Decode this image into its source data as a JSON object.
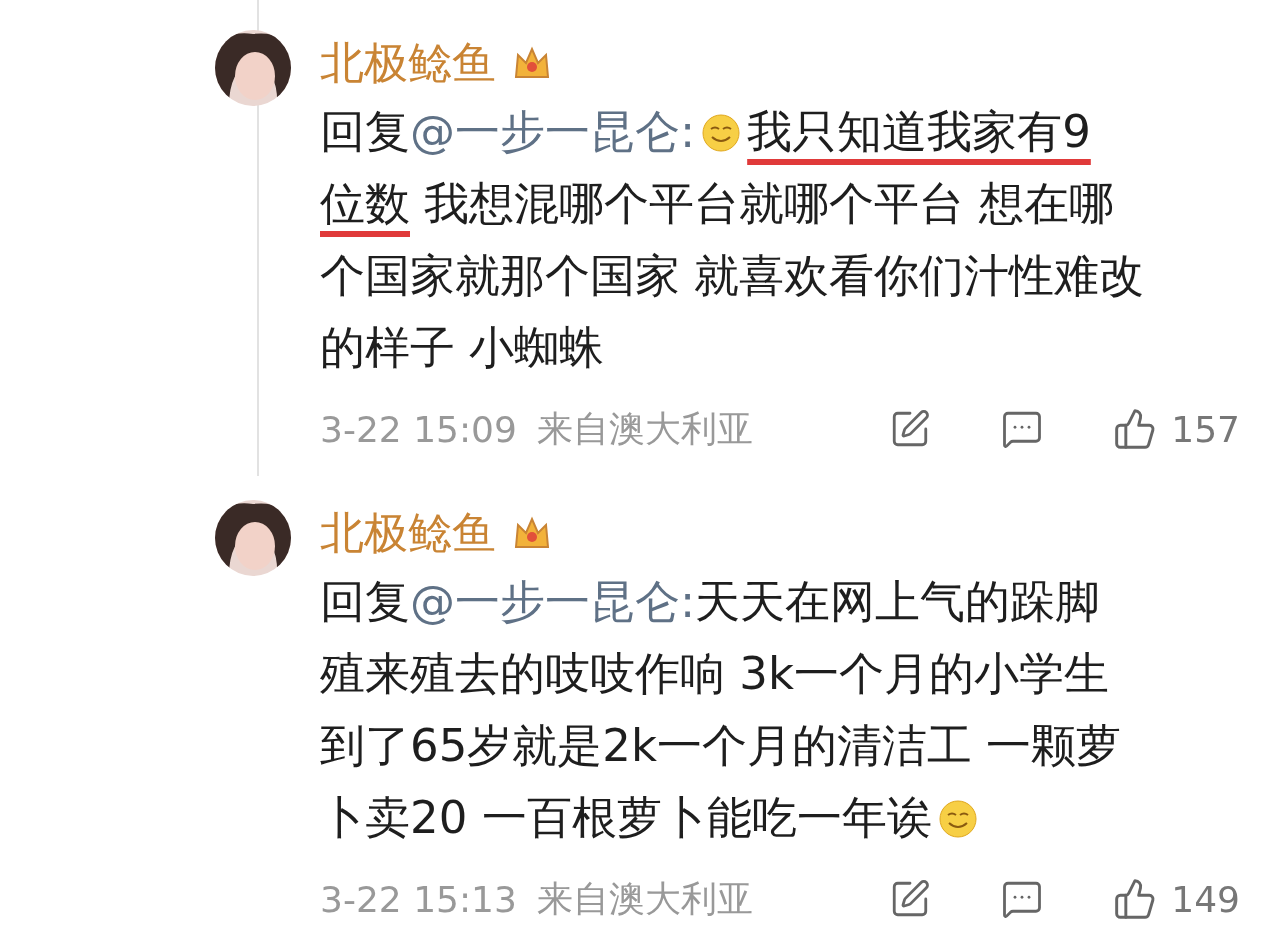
{
  "comments": [
    {
      "author": "北极鲶鱼",
      "time": "3-22 15:09",
      "source": "来自澳大利亚",
      "likes": "157",
      "lines": [
        [
          {
            "kind": "text",
            "text": "回复"
          },
          {
            "kind": "mention",
            "text": "@一步一昆仑:"
          },
          {
            "kind": "emoji"
          },
          {
            "kind": "text",
            "text": "我只知道我家有9",
            "underlined": true
          }
        ],
        [
          {
            "kind": "text",
            "text": "位数",
            "underlined": true
          },
          {
            "kind": "text",
            "text": " 我想混哪个平台就哪个平台 想在哪"
          }
        ],
        [
          {
            "kind": "text",
            "text": "个国家就那个国家 就喜欢看你们汁性难改"
          }
        ],
        [
          {
            "kind": "text",
            "text": "的样子 小蜘蛛"
          }
        ]
      ]
    },
    {
      "author": "北极鲶鱼",
      "time": "3-22 15:13",
      "source": "来自澳大利亚",
      "likes": "149",
      "lines": [
        [
          {
            "kind": "text",
            "text": "回复"
          },
          {
            "kind": "mention",
            "text": "@一步一昆仑:"
          },
          {
            "kind": "text",
            "text": "天天在网上气的跺脚"
          }
        ],
        [
          {
            "kind": "text",
            "text": "殖来殖去的吱吱作响 3k一个月的小学生"
          }
        ],
        [
          {
            "kind": "text",
            "text": "到了65岁就是2k一个月的清洁工 一颗萝"
          }
        ],
        [
          {
            "kind": "text",
            "text": "卜卖20 一百根萝卜能吃一年诶"
          },
          {
            "kind": "emoji"
          }
        ]
      ]
    }
  ]
}
